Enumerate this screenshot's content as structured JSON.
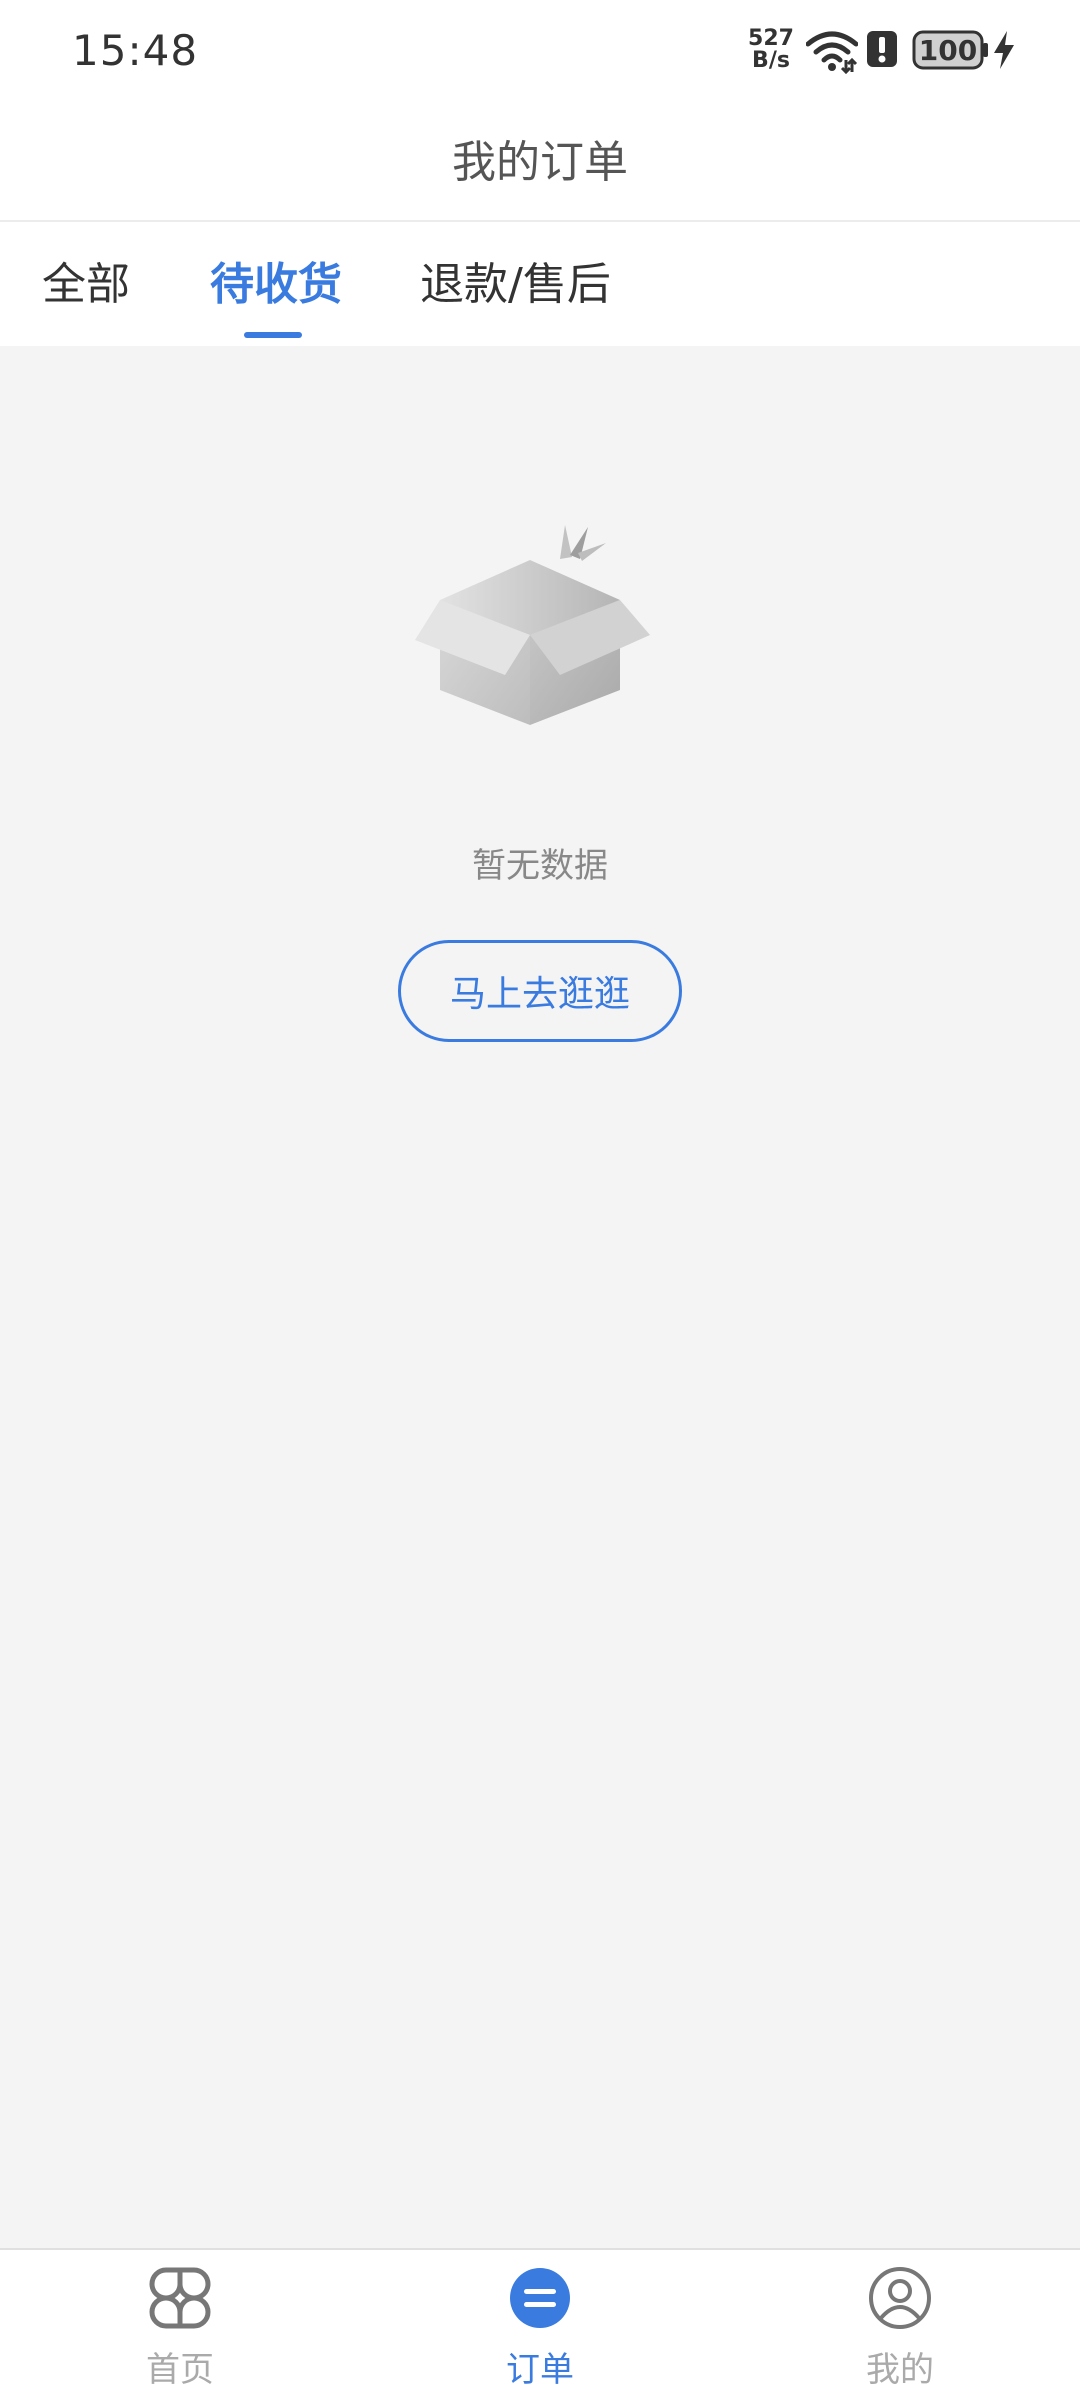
{
  "status_bar": {
    "time": "15:48",
    "net_speed_value": "527",
    "net_speed_unit": "B/s",
    "battery": "100",
    "icons": [
      "wifi-icon",
      "alert-icon",
      "battery-icon",
      "charging-icon"
    ]
  },
  "header": {
    "title": "我的订单"
  },
  "tabs": [
    {
      "label": "全部",
      "active": false
    },
    {
      "label": "待收货",
      "active": true
    },
    {
      "label": "退款/售后",
      "active": false
    }
  ],
  "empty_state": {
    "icon": "empty-box-icon",
    "message": "暂无数据",
    "button_label": "马上去逛逛"
  },
  "bottom_nav": [
    {
      "label": "首页",
      "icon": "home-grid-icon",
      "active": false
    },
    {
      "label": "订单",
      "icon": "orders-icon",
      "active": true
    },
    {
      "label": "我的",
      "icon": "profile-icon",
      "active": false
    }
  ],
  "colors": {
    "accent": "#3a7be0",
    "background": "#f4f4f5",
    "text_muted": "#888888",
    "nav_inactive": "#aaaaaa"
  }
}
